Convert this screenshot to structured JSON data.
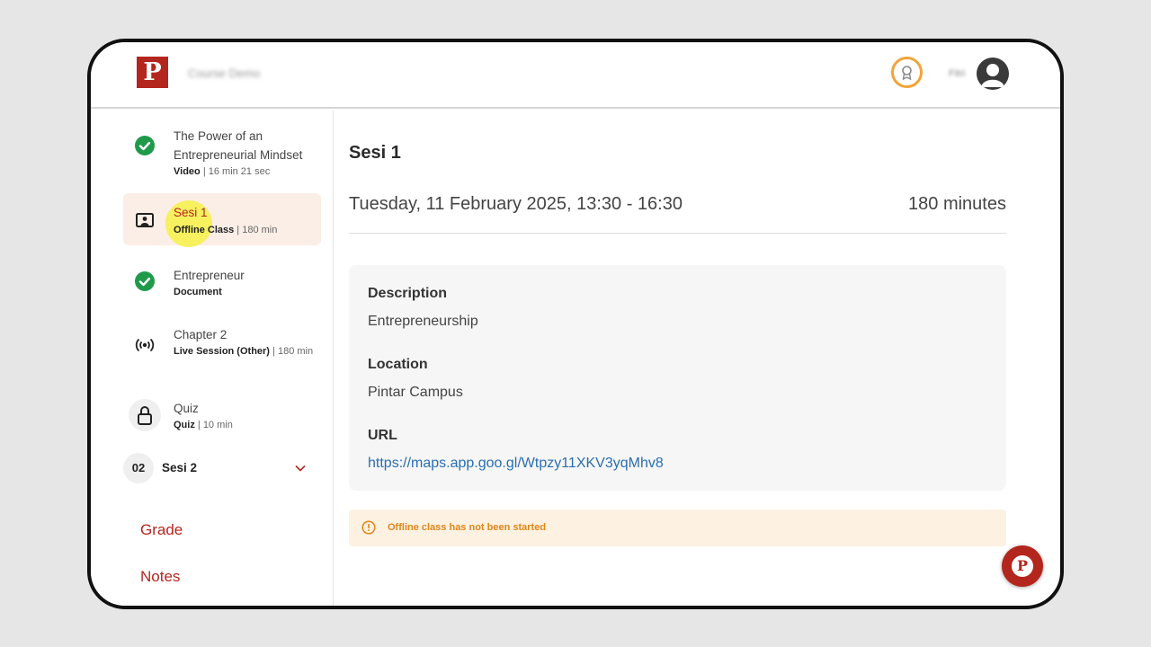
{
  "header": {
    "logo_letter": "P",
    "course_name": "Course Demo",
    "user_name": "Fitri"
  },
  "sidebar": {
    "lessons": [
      {
        "title": "The Power of an Entrepreneurial Mindset",
        "type": "Video",
        "detail": " | 16 min 21 sec",
        "status_icon": "check-icon"
      },
      {
        "title": "Sesi 1",
        "type": "Offline Class",
        "detail": " | 180 min",
        "status_icon": "classroom-icon",
        "active": true
      },
      {
        "title": "Entrepreneur",
        "type": "Document",
        "detail": "",
        "status_icon": "check-icon"
      },
      {
        "title": "Chapter 2",
        "type": "Live Session (Other)",
        "detail": " | 180 min",
        "status_icon": "broadcast-icon"
      },
      {
        "title": "Quiz",
        "type": "Quiz",
        "detail": " | 10 min",
        "status_icon": "lock-icon"
      }
    ],
    "section": {
      "number": "02",
      "label": "Sesi 2"
    },
    "links": {
      "grade": "Grade",
      "notes": "Notes"
    }
  },
  "main": {
    "title": "Sesi 1",
    "datetime": "Tuesday, 11 February 2025, 13:30 - 16:30",
    "duration": "180 minutes",
    "description_label": "Description",
    "description_value": "Entrepreneurship",
    "location_label": "Location",
    "location_value": "Pintar Campus",
    "url_label": "URL",
    "url_value": "https://maps.app.goo.gl/Wtpzy11XKV3yqMhv8",
    "notice": "Offline class has not been started"
  },
  "colors": {
    "brand": "#b3261e",
    "success": "#1f9a4a",
    "active_bg": "#fbeee6",
    "notice_bg": "#fdf1e1",
    "notice_text": "#e0861a",
    "link": "#2a6eb3"
  }
}
